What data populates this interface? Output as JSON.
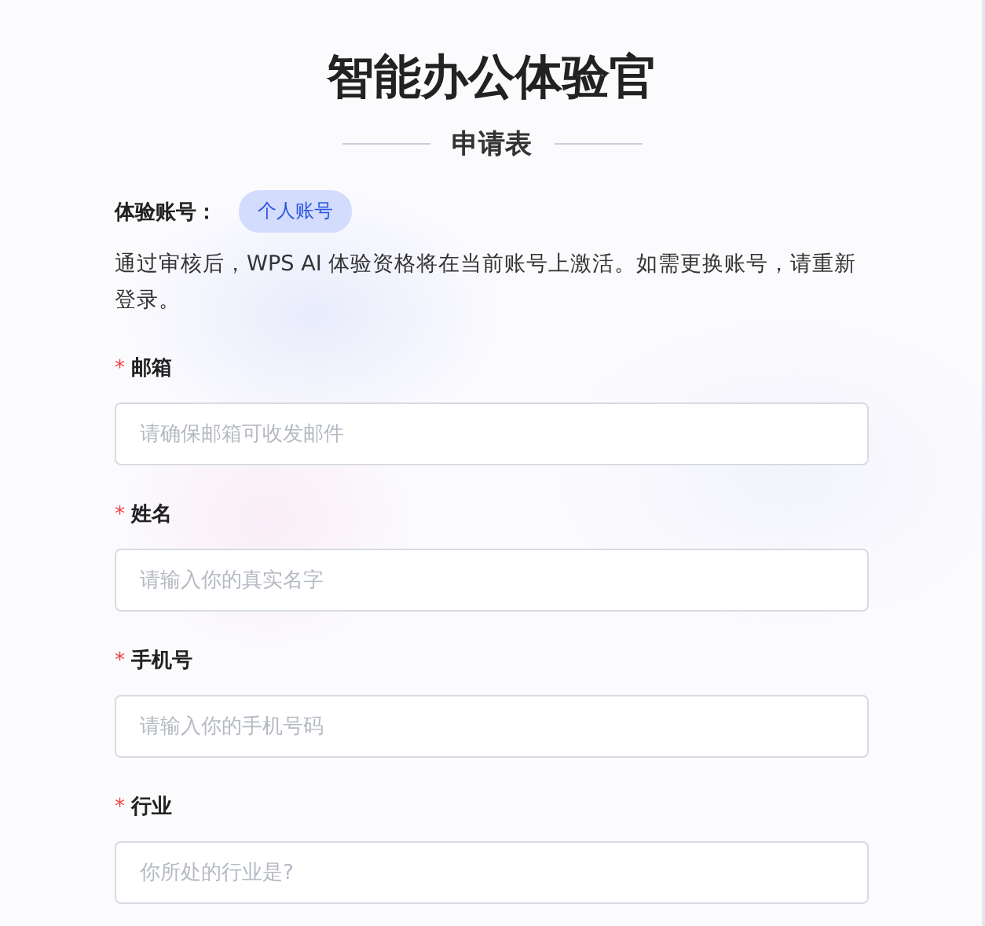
{
  "title": "智能办公体验官",
  "subtitle": "申请表",
  "account": {
    "label": "体验账号：",
    "badge": "个人账号"
  },
  "notice": "通过审核后，WPS AI 体验资格将在当前账号上激活。如需更换账号，请重新登录。",
  "fields": [
    {
      "label": "邮箱",
      "required_mark": "*",
      "placeholder": "请确保邮箱可收发邮件"
    },
    {
      "label": "姓名",
      "required_mark": "*",
      "placeholder": "请输入你的真实名字"
    },
    {
      "label": "手机号",
      "required_mark": "*",
      "placeholder": "请输入你的手机号码"
    },
    {
      "label": "行业",
      "required_mark": "*",
      "placeholder": "你所处的行业是?"
    }
  ]
}
